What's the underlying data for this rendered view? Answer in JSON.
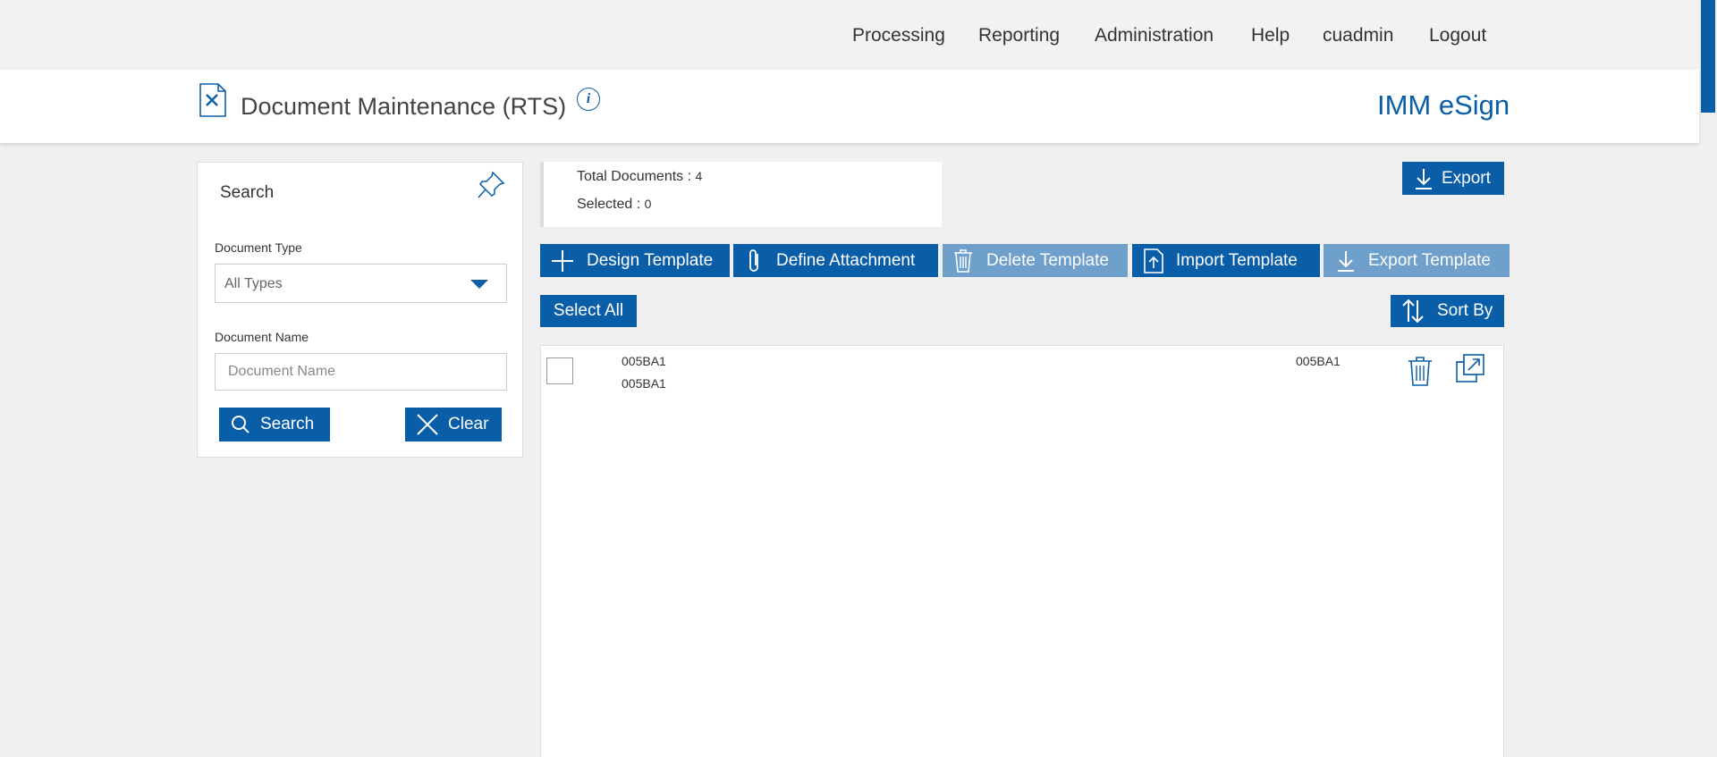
{
  "nav": {
    "processing": "Processing",
    "reporting": "Reporting",
    "administration": "Administration",
    "help": "Help",
    "user": "cuadmin",
    "logout": "Logout"
  },
  "header": {
    "title": "Document Maintenance (RTS)",
    "info_glyph": "i",
    "brand": "IMM eSign"
  },
  "search": {
    "title": "Search",
    "doc_type_label": "Document Type",
    "doc_type_value": "All Types",
    "doc_name_label": "Document Name",
    "doc_name_placeholder": "Document Name",
    "search_button": "Search",
    "clear_button": "Clear"
  },
  "summary": {
    "total_label": "Total Documents : ",
    "total_value": "4",
    "selected_label": "Selected : ",
    "selected_value": "0"
  },
  "toolbar": {
    "export": "Export",
    "design_template": "Design Template",
    "define_attachment": "Define Attachment",
    "delete_template": "Delete Template",
    "import_template": "Import Template",
    "export_template": "Export Template",
    "select_all": "Select All",
    "sort_by": "Sort By"
  },
  "documents": [
    {
      "name": "005BA1",
      "subtitle": "005BA1",
      "code": "005BA1"
    }
  ],
  "colors": {
    "accent": "#0a5ea8",
    "accent_disabled": "#6f9fcb",
    "background": "#f0f0f0"
  },
  "icons": [
    "document-icon",
    "info-icon",
    "pin-icon",
    "chevron-down-icon",
    "search-icon",
    "close-icon",
    "download-icon",
    "plus-icon",
    "paperclip-icon",
    "trash-icon",
    "upload-file-icon",
    "sort-icon",
    "open-external-icon"
  ]
}
